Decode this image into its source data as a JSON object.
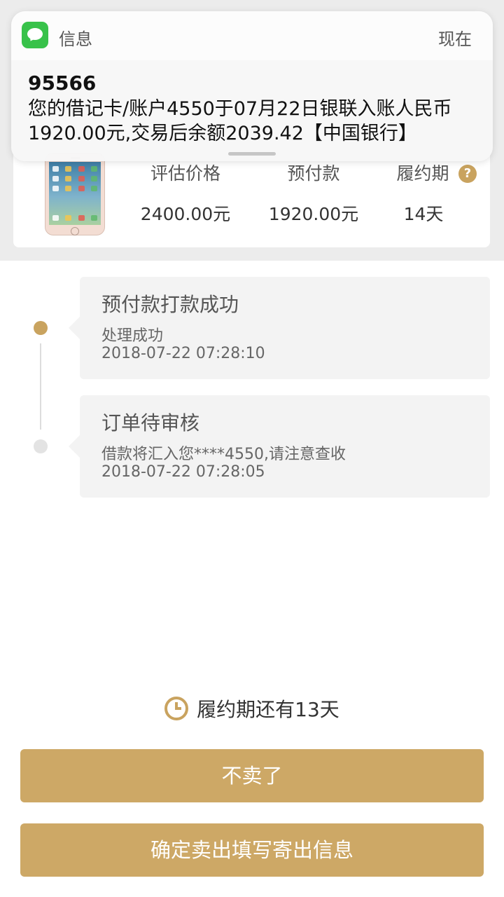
{
  "notification": {
    "app_name": "信息",
    "time": "现在",
    "sender": "95566",
    "body": "您的借记卡/账户4550于07月22日银联入账人民币1920.00元,交易后余额2039.42【中国银行】"
  },
  "product": {
    "labels": [
      "评估价格",
      "预付款",
      "履约期"
    ],
    "values": [
      "2400.00元",
      "1920.00元",
      "14天"
    ],
    "help_icon": "?"
  },
  "timeline": [
    {
      "title": "预付款打款成功",
      "status": "处理成功",
      "time": "2018-07-22 07:28:10",
      "active": true
    },
    {
      "title": "订单待审核",
      "status": "借款将汇入您****4550,请注意查收",
      "time": "2018-07-22 07:28:05",
      "active": false
    }
  ],
  "countdown": {
    "text": "履约期还有13天",
    "icon": "clock-icon"
  },
  "buttons": {
    "cancel": "不卖了",
    "confirm": "确定卖出填写寄出信息"
  },
  "colors": {
    "accent": "#c9a35f",
    "button": "#cda866",
    "message_green": "#38c24a"
  }
}
